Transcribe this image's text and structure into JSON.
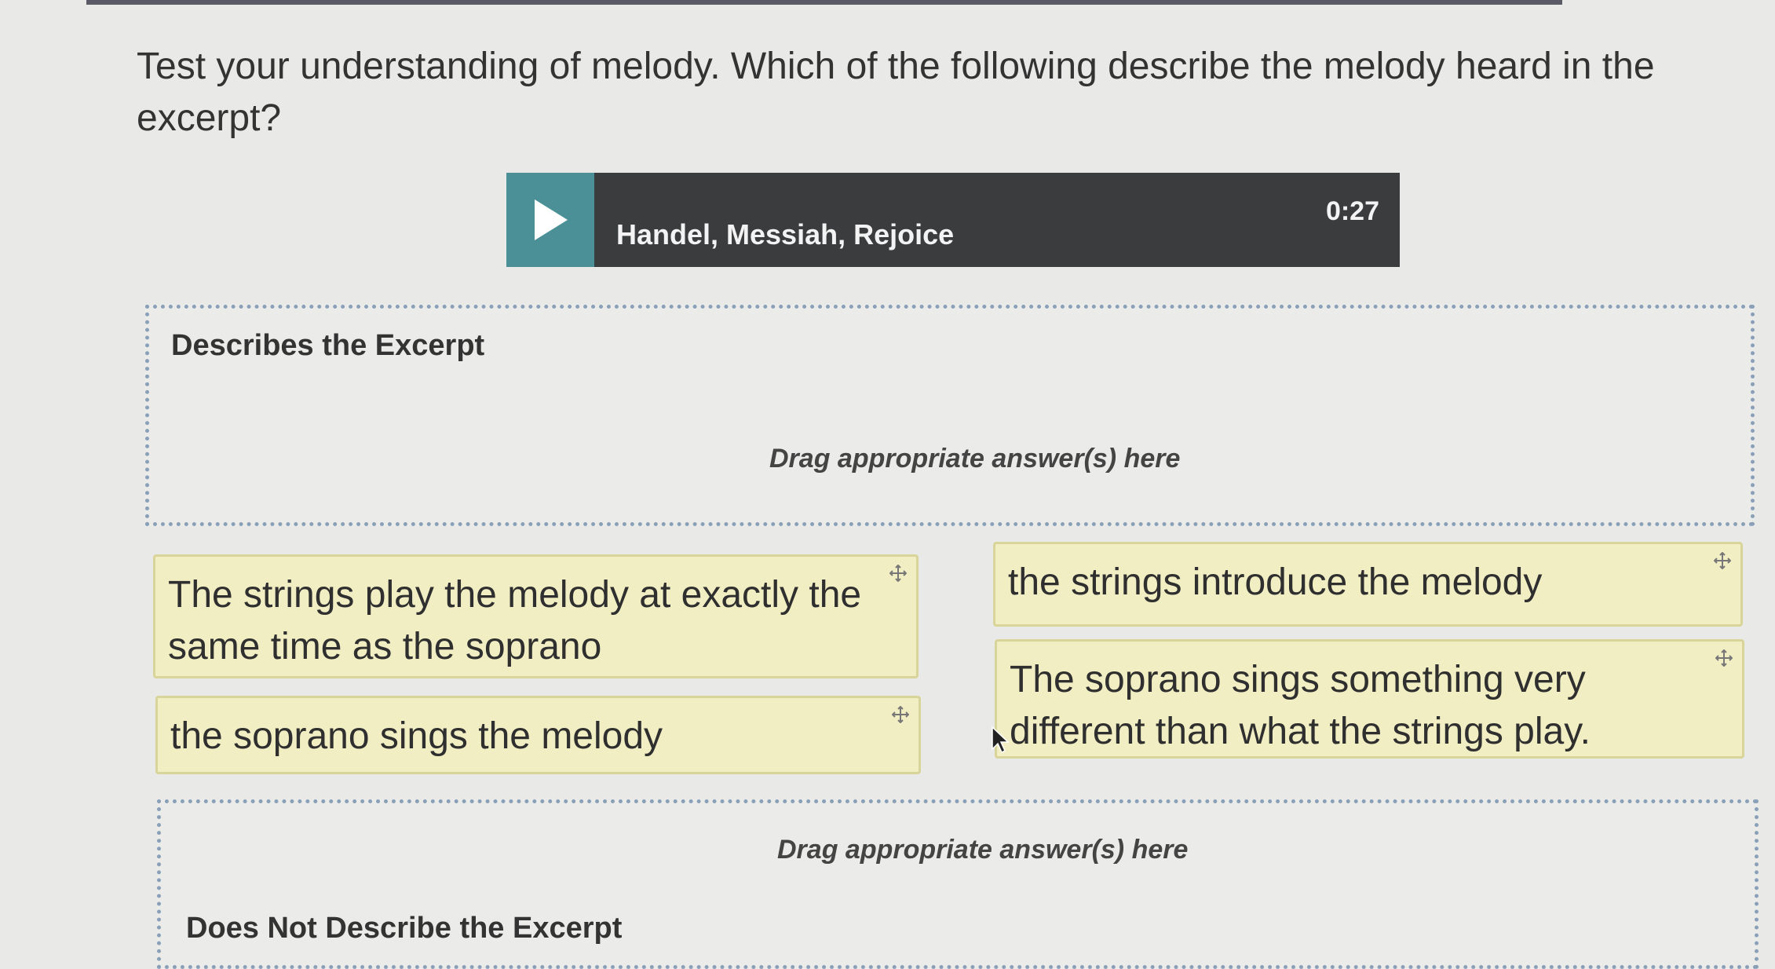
{
  "question": {
    "text": "Test your understanding of melody. Which of the following describe the melody heard in the excerpt?"
  },
  "player": {
    "play_icon": "play-icon",
    "track_title": "Handel, Messiah, Rejoice",
    "time": "0:27",
    "accent_color": "#4b8f97"
  },
  "zones": {
    "describes": {
      "title": "Describes the Excerpt",
      "hint": "Drag appropriate answer(s) here"
    },
    "does_not_describe": {
      "title": "Does Not Describe the Excerpt",
      "hint": "Drag appropriate answer(s) here"
    }
  },
  "answers": [
    {
      "text": "The strings play the melody at exactly the same time as the soprano",
      "icon": "move-icon"
    },
    {
      "text": "the soprano sings the melody",
      "icon": "move-icon"
    },
    {
      "text": "the strings introduce the melody",
      "icon": "move-icon"
    },
    {
      "text": "The soprano sings something very different than what the strings play.",
      "icon": "move-icon"
    }
  ],
  "colors": {
    "card_bg": "#f1eec3",
    "dropzone_border": "#8aa0b8",
    "player_bg": "#3a3c3e"
  }
}
